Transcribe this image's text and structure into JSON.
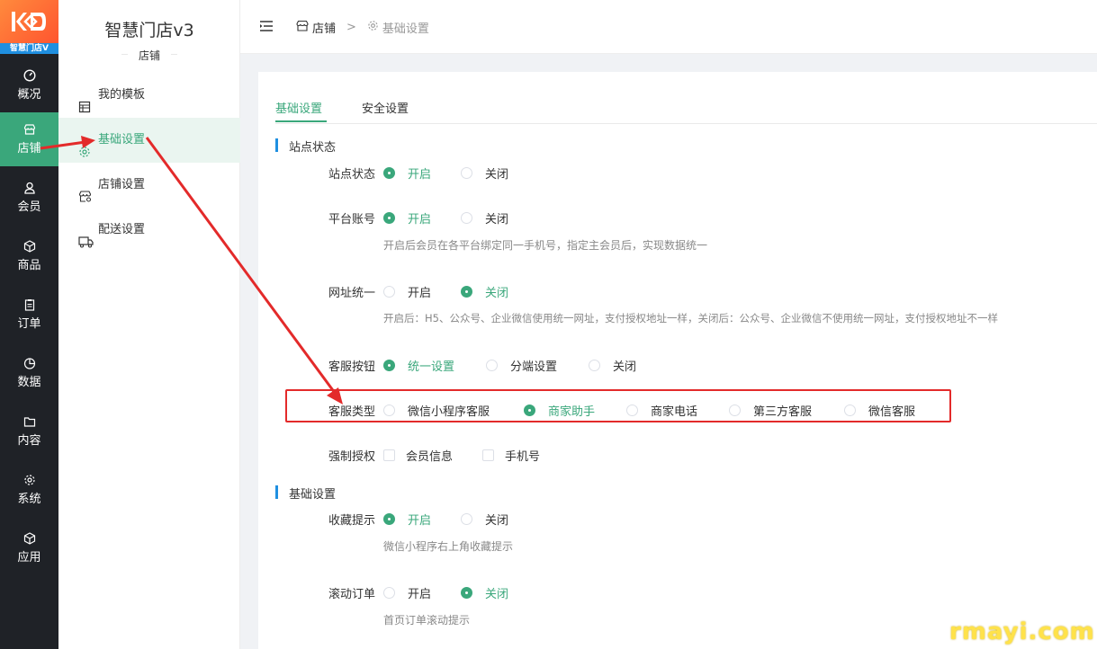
{
  "logo": {
    "text": "智慧门店V",
    "icon": "kd-logo"
  },
  "nav": [
    {
      "label": "概况",
      "icon": "gauge-icon"
    },
    {
      "label": "店铺",
      "icon": "store-icon",
      "active": true
    },
    {
      "label": "会员",
      "icon": "user-icon"
    },
    {
      "label": "商品",
      "icon": "box-icon"
    },
    {
      "label": "订单",
      "icon": "clipboard-icon"
    },
    {
      "label": "数据",
      "icon": "pie-icon"
    },
    {
      "label": "内容",
      "icon": "folder-icon"
    },
    {
      "label": "系统",
      "icon": "gear-icon"
    },
    {
      "label": "应用",
      "icon": "cube-icon"
    }
  ],
  "sidebar": {
    "title": "智慧门店v3",
    "subtitle": "店铺",
    "items": [
      {
        "label": "我的模板",
        "icon": "template-icon"
      },
      {
        "label": "基础设置",
        "icon": "gear-icon",
        "active": true
      },
      {
        "label": "店铺设置",
        "icon": "shop-settings-icon"
      },
      {
        "label": "配送设置",
        "icon": "truck-icon"
      }
    ]
  },
  "header": {
    "breadcrumb": [
      {
        "label": "店铺",
        "icon": "store-icon"
      },
      {
        "label": "基础设置",
        "icon": "gear-icon"
      }
    ],
    "separator": ">"
  },
  "tabs": [
    {
      "label": "基础设置",
      "active": true
    },
    {
      "label": "安全设置"
    }
  ],
  "sections": {
    "site_status": "站点状态",
    "basic": "基础设置"
  },
  "fields": {
    "site_status": {
      "label": "站点状态",
      "options": [
        "开启",
        "关闭"
      ],
      "selected": "开启"
    },
    "platform_account": {
      "label": "平台账号",
      "options": [
        "开启",
        "关闭"
      ],
      "selected": "开启",
      "hint": "开启后会员在各平台绑定同一手机号，指定主会员后，实现数据统一"
    },
    "url_unify": {
      "label": "网址统一",
      "options": [
        "开启",
        "关闭"
      ],
      "selected": "关闭",
      "hint": "开启后：H5、公众号、企业微信使用统一网址，支付授权地址一样，关闭后：公众号、企业微信不使用统一网址，支付授权地址不一样"
    },
    "cs_button": {
      "label": "客服按钮",
      "options": [
        "统一设置",
        "分端设置",
        "关闭"
      ],
      "selected": "统一设置"
    },
    "cs_type": {
      "label": "客服类型",
      "options": [
        "微信小程序客服",
        "商家助手",
        "商家电话",
        "第三方客服",
        "微信客服"
      ],
      "selected": "商家助手"
    },
    "force_auth": {
      "label": "强制授权",
      "options": [
        "会员信息",
        "手机号"
      ]
    },
    "favorite_tip": {
      "label": "收藏提示",
      "options": [
        "开启",
        "关闭"
      ],
      "selected": "开启",
      "hint": "微信小程序右上角收藏提示"
    },
    "scroll_order": {
      "label": "滚动订单",
      "options": [
        "开启",
        "关闭"
      ],
      "selected": "关闭",
      "hint": "首页订单滚动提示"
    }
  },
  "colors": {
    "accent": "#3aa77b",
    "nav_bg": "#1f2227",
    "annotation": "#e32a2a",
    "section_bar": "#1f8fe0"
  },
  "watermark": "rmayi.com"
}
